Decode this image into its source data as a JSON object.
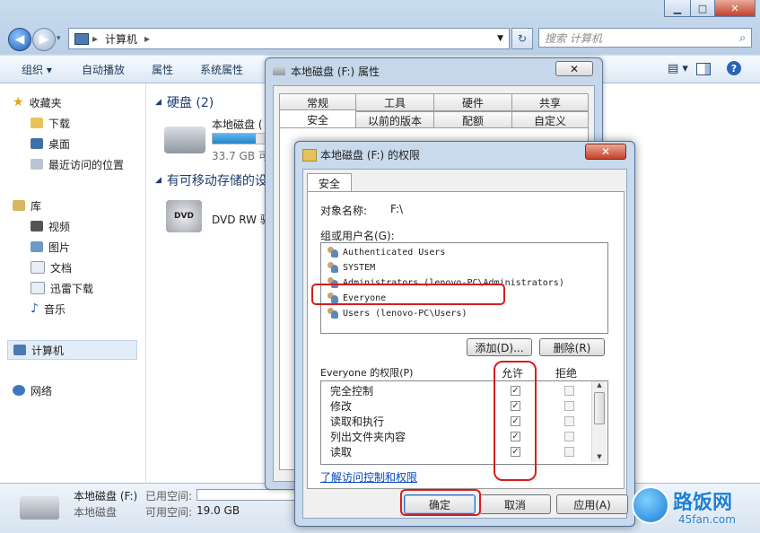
{
  "explorer": {
    "address_crumbs": [
      "计算机"
    ],
    "search_placeholder": "搜索 计算机",
    "toolbar": [
      "组织",
      "自动播放",
      "属性",
      "系统属性"
    ],
    "nav": {
      "favorites": "收藏夹",
      "favorites_items": [
        "下载",
        "桌面",
        "最近访问的位置"
      ],
      "libraries": "库",
      "libraries_items": [
        "视频",
        "图片",
        "文档",
        "迅雷下载",
        "音乐"
      ],
      "computer": "计算机",
      "network": "网络"
    },
    "content": {
      "group_hdd": "硬盘 (2)",
      "drive_name": "本地磁盘 (",
      "drive_free": "33.7 GB 可",
      "drive_fill": 0.8,
      "group_removable": "有可移动存储的设",
      "dvd_name": "DVD RW 驱"
    },
    "details": {
      "name": "本地磁盘 (F:)",
      "type": "本地磁盘",
      "used_label": "已用空间:",
      "free_label": "可用空间:",
      "free_value": "19.0 GB"
    }
  },
  "props": {
    "title": "本地磁盘 (F:) 属性",
    "tabs_row1": [
      "常规",
      "工具",
      "硬件",
      "共享"
    ],
    "tabs_row2": [
      "安全",
      "以前的版本",
      "配额",
      "自定义"
    ]
  },
  "perm": {
    "title": "本地磁盘 (F:) 的权限",
    "tab": "安全",
    "object_label": "对象名称:",
    "object_value": "F:\\",
    "group_label": "组或用户名(G):",
    "users": [
      "Authenticated Users",
      "SYSTEM",
      "Administrators (lenovo-PC\\Administrators)",
      "Everyone",
      "Users (lenovo-PC\\Users)"
    ],
    "add_btn": "添加(D)...",
    "remove_btn": "删除(R)",
    "perm_for": "Everyone 的权限(P)",
    "allow_col": "允许",
    "deny_col": "拒绝",
    "permissions": [
      {
        "name": "完全控制",
        "allow": true,
        "deny": false
      },
      {
        "name": "修改",
        "allow": true,
        "deny": false
      },
      {
        "name": "读取和执行",
        "allow": true,
        "deny": false
      },
      {
        "name": "列出文件夹内容",
        "allow": true,
        "deny": false
      },
      {
        "name": "读取",
        "allow": true,
        "deny": false
      }
    ],
    "link": "了解访问控制和权限",
    "ok": "确定",
    "cancel": "取消",
    "apply": "应用(A)"
  },
  "watermark": {
    "brand": "路饭网",
    "url": "45fan.com"
  },
  "colors": {
    "highlight_red": "#d71d1d",
    "accent_blue": "#1e5fb8"
  }
}
